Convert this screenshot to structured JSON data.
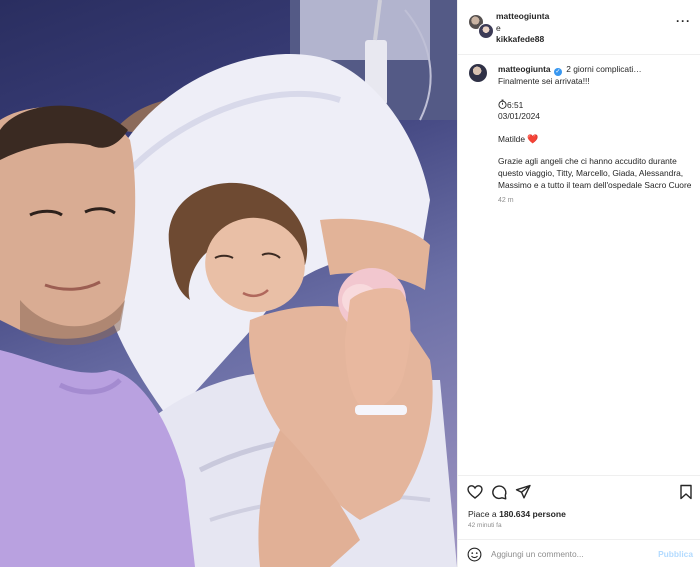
{
  "header": {
    "user1": "matteogiunta",
    "conj": "e",
    "user2": "kikkafede88",
    "more": "···"
  },
  "caption": {
    "user": "matteogiunta",
    "line1": "2 giorni complicati…",
    "line2": "Finalmente sei arrivata!!!",
    "time_of_birth": "6:51",
    "date": "03/01/2024",
    "name": "Matilde",
    "name_emoji": "❤️",
    "thanks": "Grazie agli angeli che ci hanno accudito durante questo viaggio, Titty, Marcello, Giada, Alessandra, Massimo e a tutto il team dell'ospedale Sacro Cuore",
    "posted": "42 m"
  },
  "actions": {
    "likes_prefix": "Piace a",
    "likes_count": "180.634",
    "likes_suffix": "persone",
    "ago": "42 minuti fa"
  },
  "comment_box": {
    "placeholder": "Aggiungi un commento...",
    "publish": "Pubblica"
  },
  "icons": {
    "like": "heart-icon",
    "comment": "comment-icon",
    "share": "share-icon",
    "save": "bookmark-icon",
    "emoji": "emoji-icon",
    "verified": "verified-badge-icon",
    "timer": "stopwatch-icon"
  },
  "colors": {
    "verified": "#3897f0",
    "publish": "#b3dbff",
    "muted": "#8e8e8e",
    "text": "#262626"
  }
}
